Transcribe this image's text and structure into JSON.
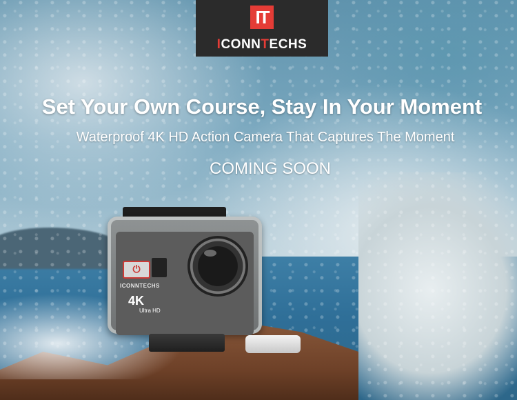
{
  "brand": {
    "logo_mark": "IT",
    "logo_word_first": "I",
    "logo_word_mid": "CONN",
    "logo_word_t": "T",
    "logo_word_end": "ECHS",
    "accent_color": "#e43c36"
  },
  "hero": {
    "headline": "Set Your Own Course, Stay In Your Moment",
    "subheadline": "Waterproof 4K HD Action Camera That Captures The Moment",
    "status": "COMING SOON"
  },
  "product": {
    "brand_text": "ICONNTECHS",
    "resolution_badge": "4K",
    "resolution_sub": "Ultra HD",
    "power_icon": "power-icon"
  }
}
